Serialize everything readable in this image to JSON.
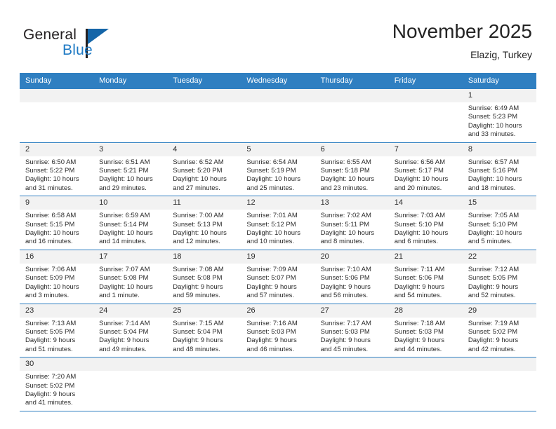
{
  "brand": {
    "name_part1": "General",
    "name_part2": "Blue"
  },
  "header": {
    "title": "November 2025",
    "subtitle": "Elazig, Turkey"
  },
  "colors": {
    "header_blue": "#2f7fc1",
    "logo_blue": "#1f7ac4",
    "daynum_bg": "#f2f2f2",
    "text": "#2b2b2b"
  },
  "weekdays": [
    "Sunday",
    "Monday",
    "Tuesday",
    "Wednesday",
    "Thursday",
    "Friday",
    "Saturday"
  ],
  "weeks": [
    [
      {
        "day": "",
        "empty": true,
        "l1": "",
        "l2": "",
        "l3": "",
        "l4": ""
      },
      {
        "day": "",
        "empty": true,
        "l1": "",
        "l2": "",
        "l3": "",
        "l4": ""
      },
      {
        "day": "",
        "empty": true,
        "l1": "",
        "l2": "",
        "l3": "",
        "l4": ""
      },
      {
        "day": "",
        "empty": true,
        "l1": "",
        "l2": "",
        "l3": "",
        "l4": ""
      },
      {
        "day": "",
        "empty": true,
        "l1": "",
        "l2": "",
        "l3": "",
        "l4": ""
      },
      {
        "day": "",
        "empty": true,
        "l1": "",
        "l2": "",
        "l3": "",
        "l4": ""
      },
      {
        "day": "1",
        "empty": false,
        "l1": "Sunrise: 6:49 AM",
        "l2": "Sunset: 5:23 PM",
        "l3": "Daylight: 10 hours",
        "l4": "and 33 minutes."
      }
    ],
    [
      {
        "day": "2",
        "empty": false,
        "l1": "Sunrise: 6:50 AM",
        "l2": "Sunset: 5:22 PM",
        "l3": "Daylight: 10 hours",
        "l4": "and 31 minutes."
      },
      {
        "day": "3",
        "empty": false,
        "l1": "Sunrise: 6:51 AM",
        "l2": "Sunset: 5:21 PM",
        "l3": "Daylight: 10 hours",
        "l4": "and 29 minutes."
      },
      {
        "day": "4",
        "empty": false,
        "l1": "Sunrise: 6:52 AM",
        "l2": "Sunset: 5:20 PM",
        "l3": "Daylight: 10 hours",
        "l4": "and 27 minutes."
      },
      {
        "day": "5",
        "empty": false,
        "l1": "Sunrise: 6:54 AM",
        "l2": "Sunset: 5:19 PM",
        "l3": "Daylight: 10 hours",
        "l4": "and 25 minutes."
      },
      {
        "day": "6",
        "empty": false,
        "l1": "Sunrise: 6:55 AM",
        "l2": "Sunset: 5:18 PM",
        "l3": "Daylight: 10 hours",
        "l4": "and 23 minutes."
      },
      {
        "day": "7",
        "empty": false,
        "l1": "Sunrise: 6:56 AM",
        "l2": "Sunset: 5:17 PM",
        "l3": "Daylight: 10 hours",
        "l4": "and 20 minutes."
      },
      {
        "day": "8",
        "empty": false,
        "l1": "Sunrise: 6:57 AM",
        "l2": "Sunset: 5:16 PM",
        "l3": "Daylight: 10 hours",
        "l4": "and 18 minutes."
      }
    ],
    [
      {
        "day": "9",
        "empty": false,
        "l1": "Sunrise: 6:58 AM",
        "l2": "Sunset: 5:15 PM",
        "l3": "Daylight: 10 hours",
        "l4": "and 16 minutes."
      },
      {
        "day": "10",
        "empty": false,
        "l1": "Sunrise: 6:59 AM",
        "l2": "Sunset: 5:14 PM",
        "l3": "Daylight: 10 hours",
        "l4": "and 14 minutes."
      },
      {
        "day": "11",
        "empty": false,
        "l1": "Sunrise: 7:00 AM",
        "l2": "Sunset: 5:13 PM",
        "l3": "Daylight: 10 hours",
        "l4": "and 12 minutes."
      },
      {
        "day": "12",
        "empty": false,
        "l1": "Sunrise: 7:01 AM",
        "l2": "Sunset: 5:12 PM",
        "l3": "Daylight: 10 hours",
        "l4": "and 10 minutes."
      },
      {
        "day": "13",
        "empty": false,
        "l1": "Sunrise: 7:02 AM",
        "l2": "Sunset: 5:11 PM",
        "l3": "Daylight: 10 hours",
        "l4": "and 8 minutes."
      },
      {
        "day": "14",
        "empty": false,
        "l1": "Sunrise: 7:03 AM",
        "l2": "Sunset: 5:10 PM",
        "l3": "Daylight: 10 hours",
        "l4": "and 6 minutes."
      },
      {
        "day": "15",
        "empty": false,
        "l1": "Sunrise: 7:05 AM",
        "l2": "Sunset: 5:10 PM",
        "l3": "Daylight: 10 hours",
        "l4": "and 5 minutes."
      }
    ],
    [
      {
        "day": "16",
        "empty": false,
        "l1": "Sunrise: 7:06 AM",
        "l2": "Sunset: 5:09 PM",
        "l3": "Daylight: 10 hours",
        "l4": "and 3 minutes."
      },
      {
        "day": "17",
        "empty": false,
        "l1": "Sunrise: 7:07 AM",
        "l2": "Sunset: 5:08 PM",
        "l3": "Daylight: 10 hours",
        "l4": "and 1 minute."
      },
      {
        "day": "18",
        "empty": false,
        "l1": "Sunrise: 7:08 AM",
        "l2": "Sunset: 5:08 PM",
        "l3": "Daylight: 9 hours",
        "l4": "and 59 minutes."
      },
      {
        "day": "19",
        "empty": false,
        "l1": "Sunrise: 7:09 AM",
        "l2": "Sunset: 5:07 PM",
        "l3": "Daylight: 9 hours",
        "l4": "and 57 minutes."
      },
      {
        "day": "20",
        "empty": false,
        "l1": "Sunrise: 7:10 AM",
        "l2": "Sunset: 5:06 PM",
        "l3": "Daylight: 9 hours",
        "l4": "and 56 minutes."
      },
      {
        "day": "21",
        "empty": false,
        "l1": "Sunrise: 7:11 AM",
        "l2": "Sunset: 5:06 PM",
        "l3": "Daylight: 9 hours",
        "l4": "and 54 minutes."
      },
      {
        "day": "22",
        "empty": false,
        "l1": "Sunrise: 7:12 AM",
        "l2": "Sunset: 5:05 PM",
        "l3": "Daylight: 9 hours",
        "l4": "and 52 minutes."
      }
    ],
    [
      {
        "day": "23",
        "empty": false,
        "l1": "Sunrise: 7:13 AM",
        "l2": "Sunset: 5:05 PM",
        "l3": "Daylight: 9 hours",
        "l4": "and 51 minutes."
      },
      {
        "day": "24",
        "empty": false,
        "l1": "Sunrise: 7:14 AM",
        "l2": "Sunset: 5:04 PM",
        "l3": "Daylight: 9 hours",
        "l4": "and 49 minutes."
      },
      {
        "day": "25",
        "empty": false,
        "l1": "Sunrise: 7:15 AM",
        "l2": "Sunset: 5:04 PM",
        "l3": "Daylight: 9 hours",
        "l4": "and 48 minutes."
      },
      {
        "day": "26",
        "empty": false,
        "l1": "Sunrise: 7:16 AM",
        "l2": "Sunset: 5:03 PM",
        "l3": "Daylight: 9 hours",
        "l4": "and 46 minutes."
      },
      {
        "day": "27",
        "empty": false,
        "l1": "Sunrise: 7:17 AM",
        "l2": "Sunset: 5:03 PM",
        "l3": "Daylight: 9 hours",
        "l4": "and 45 minutes."
      },
      {
        "day": "28",
        "empty": false,
        "l1": "Sunrise: 7:18 AM",
        "l2": "Sunset: 5:03 PM",
        "l3": "Daylight: 9 hours",
        "l4": "and 44 minutes."
      },
      {
        "day": "29",
        "empty": false,
        "l1": "Sunrise: 7:19 AM",
        "l2": "Sunset: 5:02 PM",
        "l3": "Daylight: 9 hours",
        "l4": "and 42 minutes."
      }
    ],
    [
      {
        "day": "30",
        "empty": false,
        "l1": "Sunrise: 7:20 AM",
        "l2": "Sunset: 5:02 PM",
        "l3": "Daylight: 9 hours",
        "l4": "and 41 minutes."
      },
      {
        "day": "",
        "empty": true,
        "l1": "",
        "l2": "",
        "l3": "",
        "l4": ""
      },
      {
        "day": "",
        "empty": true,
        "l1": "",
        "l2": "",
        "l3": "",
        "l4": ""
      },
      {
        "day": "",
        "empty": true,
        "l1": "",
        "l2": "",
        "l3": "",
        "l4": ""
      },
      {
        "day": "",
        "empty": true,
        "l1": "",
        "l2": "",
        "l3": "",
        "l4": ""
      },
      {
        "day": "",
        "empty": true,
        "l1": "",
        "l2": "",
        "l3": "",
        "l4": ""
      },
      {
        "day": "",
        "empty": true,
        "l1": "",
        "l2": "",
        "l3": "",
        "l4": ""
      }
    ]
  ]
}
